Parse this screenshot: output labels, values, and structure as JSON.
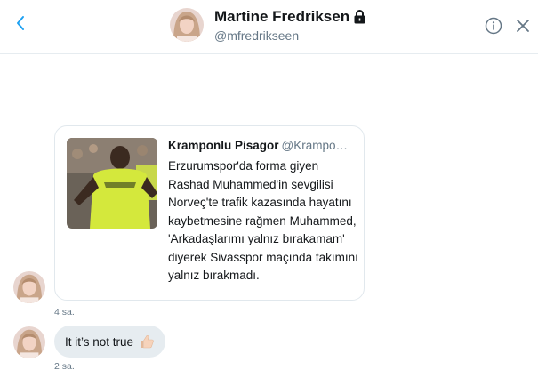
{
  "header": {
    "name": "Martine Fredriksen",
    "handle": "@mfredrikseen"
  },
  "quoted_tweet": {
    "author_name": "Kramponlu Pisagor",
    "author_handle": "@Krampo…",
    "text": "Erzurumspor'da forma giyen Rashad Muhammed'in sevgilisi Norveç'te trafik kazasında hayatını kaybetmesine rağmen Muhammed, 'Arkadaşlarımı yalnız bırakamam' diyerek Sivasspor maçında takımını yalnız bırakmadı.",
    "timestamp": "4 sa."
  },
  "reply": {
    "text": "It it’s not true",
    "emoji": "thumbs-up-light-skin",
    "timestamp": "2 sa."
  },
  "colors": {
    "accent": "#1da1f2",
    "text_secondary": "#657786",
    "bubble_bg": "#e6ecf0",
    "border": "#e1e8ed"
  },
  "icons": [
    "back-arrow-icon",
    "lock-icon",
    "info-icon",
    "close-icon"
  ]
}
